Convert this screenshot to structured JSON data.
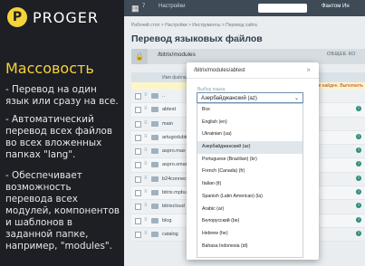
{
  "promo": {
    "brand": "PROGER",
    "logo_letter": "P",
    "title": "Массовость",
    "paragraphs": [
      "- Перевод на один язык или сразу на все.",
      "- Автоматический перевод всех файлов во всех вложенных папках \"lang\".",
      "- Обеспечивает возможность перевода всех модулей, компонентов и шаблонов в заданной папке, например, \"modules\"."
    ]
  },
  "app": {
    "topbar": {
      "grid": "▦",
      "count": "7",
      "settings": "Настройки",
      "user": "Фантом Ин"
    },
    "breadcrumbs": "Рабочий стол  >  Настройки  >  Инструменты  >  Перевод сайта",
    "page_title": "Перевод языковых файлов",
    "star": "☆",
    "toolbar": {
      "lock": "🔒",
      "path": "/bitrix/modules",
      "gen": "ОБЩЕЕ КО"
    },
    "table": {
      "headers": [
        "Имя файла/папки",
        "Ш"
      ],
      "notice": "не найден. Выполнить",
      "rows": [
        {
          "name": "..",
          "num": "",
          "info": false
        },
        {
          "name": "abtest",
          "num": "81",
          "info": true
        },
        {
          "name": "main",
          "num": "",
          "info": false
        },
        {
          "name": "artugodubko.ib",
          "num": "276",
          "info": true
        },
        {
          "name": "aspro.max",
          "num": "",
          "info": true
        },
        {
          "name": "aspro.smartcont",
          "num": "",
          "info": true
        },
        {
          "name": "b24connector",
          "num": "",
          "info": true
        },
        {
          "name": "bitrix.mpbuilder",
          "num": "",
          "info": true
        },
        {
          "name": "bitrixcloud",
          "num": "",
          "info": true
        },
        {
          "name": "blog",
          "num": "",
          "info": true
        },
        {
          "name": "catalog",
          "num": "",
          "info": true
        }
      ]
    }
  },
  "modal": {
    "path": "/bitrix/modules/abtest",
    "close": "×",
    "lang_label": "Выбор языка",
    "selected": "Азербайджанский (az)",
    "options": [
      "Все",
      "English (en)",
      "Ukrainian (ua)",
      "Азербайджанский (az)",
      "Portuguese (Brazilian) (br)",
      "French (Canada) (fr)",
      "Italian (it)",
      "Spanish (Latin American) (la)",
      "Arabic (ar)",
      "Белорусский (be)",
      "Hebrew (he)",
      "Bahasa Indonesia (id)"
    ]
  }
}
